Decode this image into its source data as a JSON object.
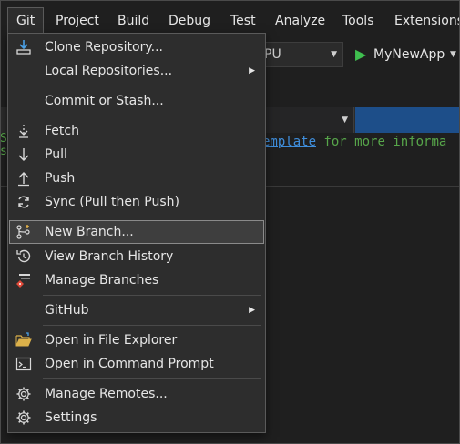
{
  "menubar": {
    "items": [
      "Git",
      "Project",
      "Build",
      "Debug",
      "Test",
      "Analyze",
      "Tools",
      "Extensions"
    ],
    "active_index": 0
  },
  "toolbar": {
    "platform_value": "PU",
    "run_label": "MyNewApp"
  },
  "editor": {
    "code_link": "emplate",
    "code_rest": " for more informa",
    "left_fragment": "S"
  },
  "git_menu": {
    "items": [
      {
        "label": "Clone Repository...",
        "icon": "clone-icon"
      },
      {
        "label": "Local Repositories...",
        "icon": "",
        "submenu": true
      },
      {
        "label": "Commit or Stash...",
        "icon": ""
      },
      {
        "label": "Fetch",
        "icon": "fetch-icon"
      },
      {
        "label": "Pull",
        "icon": "pull-icon"
      },
      {
        "label": "Push",
        "icon": "push-icon"
      },
      {
        "label": "Sync (Pull then Push)",
        "icon": "sync-icon"
      },
      {
        "label": "New Branch...",
        "icon": "new-branch-icon",
        "highlighted": true
      },
      {
        "label": "View Branch History",
        "icon": "history-icon"
      },
      {
        "label": "Manage Branches",
        "icon": "manage-branches-icon"
      },
      {
        "label": "GitHub",
        "icon": "",
        "submenu": true
      },
      {
        "label": "Open in File Explorer",
        "icon": "folder-open-icon"
      },
      {
        "label": "Open in Command Prompt",
        "icon": "terminal-icon"
      },
      {
        "label": "Manage Remotes...",
        "icon": "gear-icon"
      },
      {
        "label": "Settings",
        "icon": "gear-icon"
      }
    ]
  },
  "colors": {
    "background": "#1f1f1f",
    "menu_background": "#2d2d2d",
    "run_green": "#3fbf4f",
    "accent_blue": "#1d4e89",
    "code_green": "#57a64a"
  }
}
